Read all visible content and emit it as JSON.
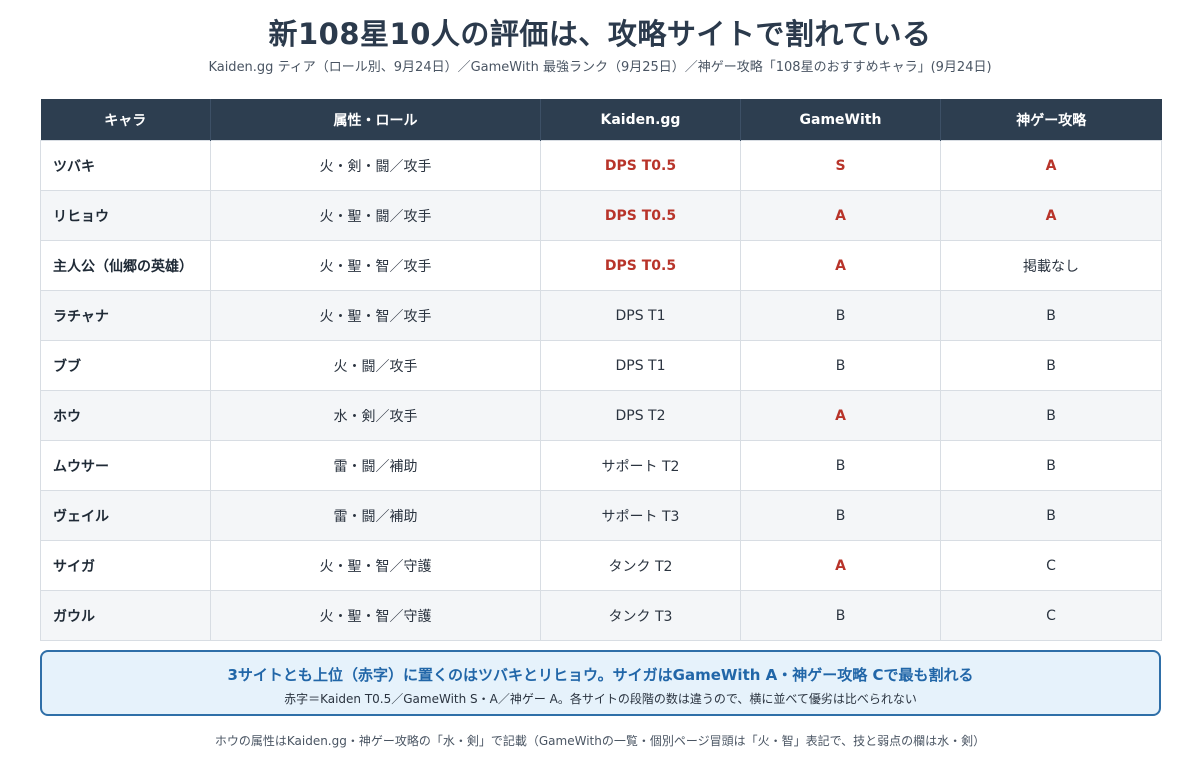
{
  "title": "新108星10人の評価は、攻略サイトで割れている",
  "subtitle": "Kaiden.gg ティア（ロール別、9月24日）／GameWith 最強ランク（9月25日）／神ゲー攻略「108星のおすすめキャラ」(9月24日)",
  "table": {
    "headers": [
      "キャラ",
      "属性・ロール",
      "Kaiden.gg",
      "GameWith",
      "神ゲー攻略"
    ],
    "rows": [
      {
        "name": "ツバキ",
        "attr": "火・剣・闘／攻手",
        "kaiden": "DPS T0.5",
        "gamewith": "S",
        "kamige": "A",
        "kaiden_red": true,
        "gamewith_red": true,
        "kamige_red": true
      },
      {
        "name": "リヒョウ",
        "attr": "火・聖・闘／攻手",
        "kaiden": "DPS T0.5",
        "gamewith": "A",
        "kamige": "A",
        "kaiden_red": true,
        "gamewith_red": true,
        "kamige_red": true
      },
      {
        "name": "主人公（仙郷の英雄）",
        "attr": "火・聖・智／攻手",
        "kaiden": "DPS T0.5",
        "gamewith": "A",
        "kamige": "掲載なし",
        "kaiden_red": true,
        "gamewith_red": true,
        "kamige_red": false
      },
      {
        "name": "ラチャナ",
        "attr": "火・聖・智／攻手",
        "kaiden": "DPS T1",
        "gamewith": "B",
        "kamige": "B",
        "kaiden_red": false,
        "gamewith_red": false,
        "kamige_red": false
      },
      {
        "name": "ブブ",
        "attr": "火・闘／攻手",
        "kaiden": "DPS T1",
        "gamewith": "B",
        "kamige": "B",
        "kaiden_red": false,
        "gamewith_red": false,
        "kamige_red": false
      },
      {
        "name": "ホウ",
        "attr": "水・剣／攻手",
        "kaiden": "DPS T2",
        "gamewith": "A",
        "kamige": "B",
        "kaiden_red": false,
        "gamewith_red": true,
        "kamige_red": false
      },
      {
        "name": "ムウサー",
        "attr": "雷・闘／補助",
        "kaiden": "サポート T2",
        "gamewith": "B",
        "kamige": "B",
        "kaiden_red": false,
        "gamewith_red": false,
        "kamige_red": false
      },
      {
        "name": "ヴェイル",
        "attr": "雷・闘／補助",
        "kaiden": "サポート T3",
        "gamewith": "B",
        "kamige": "B",
        "kaiden_red": false,
        "gamewith_red": false,
        "kamige_red": false
      },
      {
        "name": "サイガ",
        "attr": "火・聖・智／守護",
        "kaiden": "タンク T2",
        "gamewith": "A",
        "kamige": "C",
        "kaiden_red": false,
        "gamewith_red": true,
        "kamige_red": false
      },
      {
        "name": "ガウル",
        "attr": "火・聖・智／守護",
        "kaiden": "タンク T3",
        "gamewith": "B",
        "kamige": "C",
        "kaiden_red": false,
        "gamewith_red": false,
        "kamige_red": false
      }
    ]
  },
  "callout": {
    "main": "3サイトとも上位（赤字）に置くのはツバキとリヒョウ。サイガはGameWith A・神ゲー攻略 Cで最も割れる",
    "sub": "赤字＝Kaiden T0.5／GameWith S・A／神ゲー A。各サイトの段階の数は違うので、横に並べて優劣は比べられない"
  },
  "footnote": "ホウの属性はKaiden.gg・神ゲー攻略の「水・剣」で記載（GameWithの一覧・個別ページ冒頭は「火・智」表記で、技と弱点の欄は水・剣）",
  "colors": {
    "header_bg": "#2d3e50",
    "highlight_red": "#b8342a",
    "callout_border": "#2f6fa8",
    "callout_bg": "#e6f2fb",
    "callout_text": "#2166a8"
  }
}
